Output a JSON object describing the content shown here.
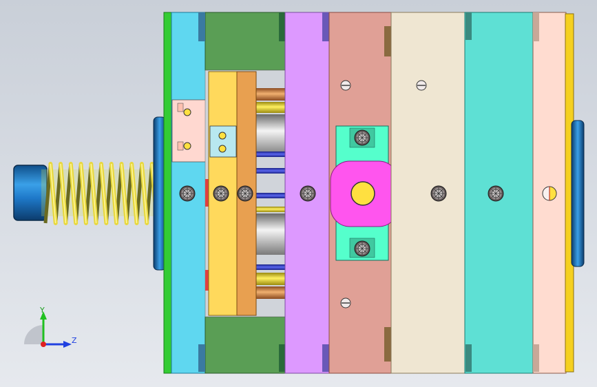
{
  "colors": {
    "background_top": "#c9cfd8",
    "background_bottom": "#e6e9ee",
    "green_plate": "#33cc33",
    "cyan_plate": "#5fd7f0",
    "dark_green_block": "#5a9e55",
    "yellow_plate": "#ffd95c",
    "orange_plate": "#e8a050",
    "lavender_plate": "#dd99ff",
    "salmon_plate": "#e0a096",
    "beige_plate": "#efe6d2",
    "teal_plate": "#5ee0d4",
    "peach_plate": "#ffdcd0",
    "gold_strip": "#f5d020",
    "blue_cylinder": "#1e78c8",
    "spring_yellow": "#e8d840",
    "magenta_core": "#ff55ee",
    "aqua_insert": "#55ffcc",
    "copper_pin": "#d08850",
    "blue_pin": "#3344cc"
  },
  "icons": {
    "spring": "coil-spring-icon",
    "screw": "screw-head-icon",
    "axis_triad": "axis-triad-icon"
  },
  "axes": {
    "y_label": "Y",
    "z_label": "Z"
  }
}
